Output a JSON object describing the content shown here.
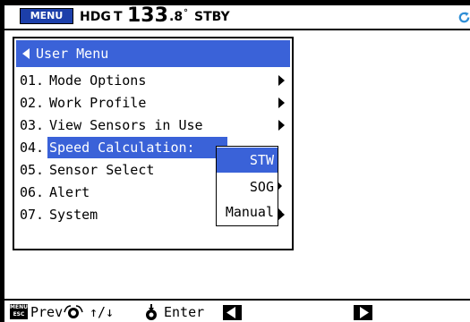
{
  "status_bar": {
    "menu_button": "MENU",
    "heading_label": "HDG",
    "heading_type": "T",
    "heading_integer": "133",
    "heading_fraction": ".8",
    "heading_unit": "°",
    "mode": "STBY"
  },
  "menu": {
    "header": "User Menu",
    "items": [
      {
        "num": "01.",
        "label": "Mode Options",
        "has_submenu": true
      },
      {
        "num": "02.",
        "label": "Work Profile",
        "has_submenu": true
      },
      {
        "num": "03.",
        "label": "View Sensors in Use",
        "has_submenu": true
      },
      {
        "num": "04.",
        "label": "Speed Calculation:",
        "has_submenu": false,
        "selected": true
      },
      {
        "num": "05.",
        "label": "Sensor Select",
        "has_submenu": false
      },
      {
        "num": "06.",
        "label": "Alert",
        "has_submenu": false
      },
      {
        "num": "07.",
        "label": "System",
        "has_submenu": true
      }
    ]
  },
  "submenu": {
    "options": [
      "STW",
      "SOG",
      "Manual"
    ],
    "selected": "STW"
  },
  "footer": {
    "menu_esc_icon_text": "MENU ESC",
    "prev_label": "Prev",
    "updown_label": "↑/↓",
    "enter_label": "Enter"
  },
  "colors": {
    "highlight": "#3a62d8",
    "menu_button": "#1c3faa",
    "refresh_icon": "#2f8fd6"
  },
  "icons": {
    "back": "triangle-left-icon",
    "submenu": "triangle-right-icon",
    "refresh": "refresh-icon",
    "knob": "rotary-knob-icon",
    "enter": "knob-press-icon",
    "page_left": "left-arrow-icon",
    "page_right": "right-arrow-icon"
  }
}
